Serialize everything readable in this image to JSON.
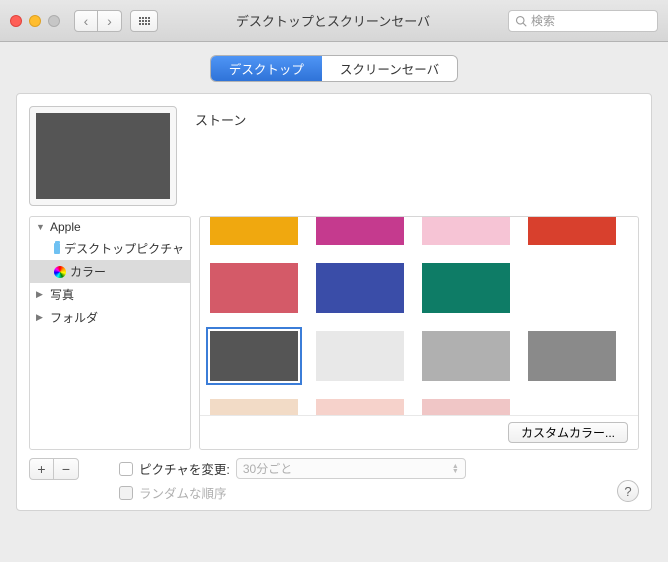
{
  "window": {
    "title": "デスクトップとスクリーンセーバ"
  },
  "search": {
    "placeholder": "検索"
  },
  "tabs": {
    "desktop": "デスクトップ",
    "screensaver": "スクリーンセーバ"
  },
  "current": {
    "label": "ストーン",
    "color": "#555555"
  },
  "sidebar": {
    "apple": "Apple",
    "desktop_pictures": "デスクトップピクチャ",
    "colors": "カラー",
    "photos": "写真",
    "folders": "フォルダ"
  },
  "swatches": {
    "row1": [
      "#f0a80f",
      "#c53a8e",
      "#f6c4d5",
      "#d8402d"
    ],
    "row2": [
      "#d45a68",
      "#3a4da8",
      "#0e7c66"
    ],
    "row3": [
      "#555555",
      "#e8e8e8",
      "#b0b0b0",
      "#8a8a8a"
    ],
    "row4": [
      "#f2dbc6",
      "#f6d2cb",
      "#f0c6c6"
    ]
  },
  "buttons": {
    "custom_color": "カスタムカラー..."
  },
  "change": {
    "label": "ピクチャを変更:",
    "interval": "30分ごと",
    "random": "ランダムな順序"
  }
}
